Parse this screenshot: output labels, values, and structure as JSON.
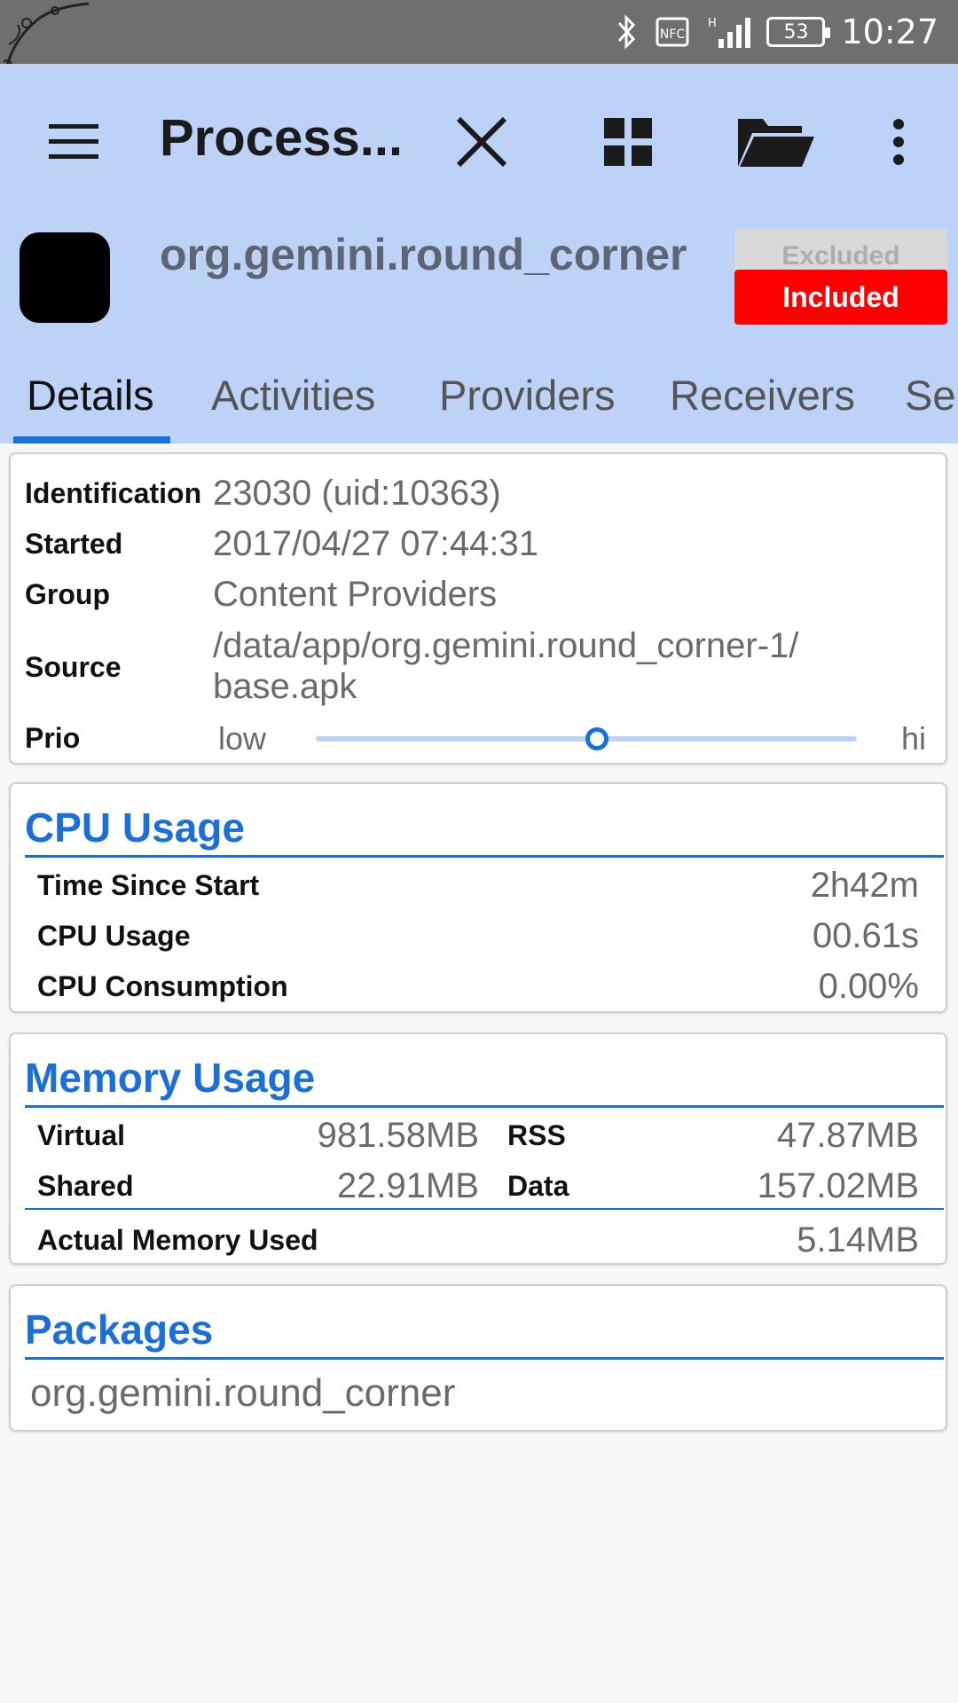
{
  "status_bar": {
    "icons": [
      "bluetooth-icon",
      "nfc-icon",
      "signal-icon"
    ],
    "battery": "53",
    "time": "10:27"
  },
  "toolbar": {
    "title": "Process...",
    "icons": [
      "menu-icon",
      "close-icon",
      "grid-icon",
      "folder-icon",
      "more-vert-icon"
    ]
  },
  "app": {
    "name": "org.gemini.round_corner",
    "toggle_excluded": "Excluded",
    "toggle_included": "Included"
  },
  "tabs": [
    {
      "label": "Details",
      "active": true
    },
    {
      "label": "Activities"
    },
    {
      "label": "Providers"
    },
    {
      "label": "Receivers"
    },
    {
      "label": "Se"
    }
  ],
  "details": {
    "identification_label": "Identification",
    "identification_value": "23030 (uid:10363)",
    "started_label": "Started",
    "started_value": "2017/04/27 07:44:31",
    "group_label": "Group",
    "group_value": "Content Providers",
    "source_label": "Source",
    "source_value_line1": "/data/app/org.gemini.round_corner-1/",
    "source_value_line2": "base.apk",
    "prio_label": "Prio",
    "prio_low": "low",
    "prio_hi": "hi",
    "prio_level_fraction": 0.52
  },
  "cpu": {
    "title": "CPU Usage",
    "rows": [
      {
        "label": "Time Since Start",
        "value": "2h42m"
      },
      {
        "label": "CPU Usage",
        "value": "00.61s"
      },
      {
        "label": "CPU Consumption",
        "value": "0.00%"
      }
    ]
  },
  "memory": {
    "title": "Memory Usage",
    "virtual_label": "Virtual",
    "virtual_value": "981.58MB",
    "rss_label": "RSS",
    "rss_value": "47.87MB",
    "shared_label": "Shared",
    "shared_value": "22.91MB",
    "data_label": "Data",
    "data_value": "157.02MB",
    "actual_label": "Actual Memory Used",
    "actual_value": "5.14MB"
  },
  "packages": {
    "title": "Packages",
    "items": [
      "org.gemini.round_corner"
    ]
  },
  "colors": {
    "accent": "#1a6fd8",
    "header_bg": "#bcd3f7",
    "included_red": "#ff0000"
  }
}
